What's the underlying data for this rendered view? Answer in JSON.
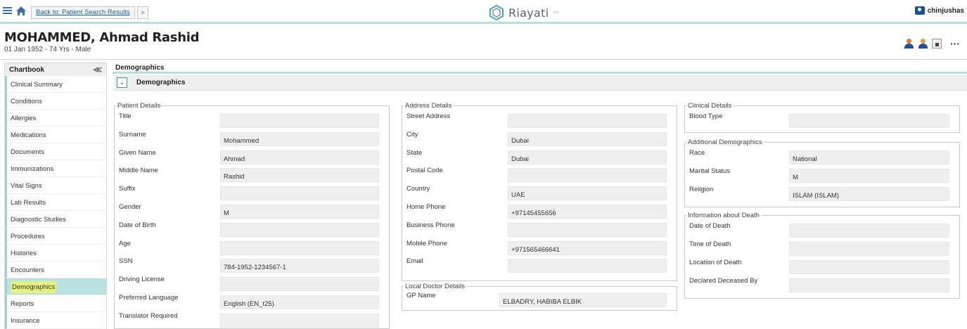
{
  "topbar": {
    "back_link": "Back to: Patient Search Results",
    "back_arrow": ">",
    "brand": "Riayati",
    "brand_sub": "≡≡≡",
    "user": "chinjushas"
  },
  "patient": {
    "name": "MOHAMMED, Ahmad Rashid",
    "info": "01 Jan 1952 - 74 Yrs - Male",
    "more": "···"
  },
  "sidebar": {
    "title": "Chartbook",
    "collapse": "≪",
    "items": [
      "Clinical Summary",
      "Conditions",
      "Allergies",
      "Medications",
      "Documents",
      "Immunizations",
      "Vital Signs",
      "Lab Results",
      "Diagnostic Studies",
      "Procedures",
      "Histories",
      "Encounters",
      "Demographics",
      "Reports",
      "Insurance"
    ],
    "active": "Demographics"
  },
  "main": {
    "title": "Demographics",
    "section_title": "Demographics",
    "toggle": "⌄"
  },
  "patient_details": {
    "legend": "Patient Details",
    "fields": [
      {
        "label": "Title",
        "value": ""
      },
      {
        "label": "Surname",
        "value": "Mohammed"
      },
      {
        "label": "Given Name",
        "value": "Ahmad"
      },
      {
        "label": "Middle Name",
        "value": "Rashid"
      },
      {
        "label": "Suffix",
        "value": ""
      },
      {
        "label": "Gender",
        "value": "M"
      },
      {
        "label": "Date of Birth",
        "value": ""
      },
      {
        "label": "Age",
        "value": ""
      },
      {
        "label": "SSN",
        "value": "784-1952-1234567-1"
      },
      {
        "label": "Driving License",
        "value": ""
      },
      {
        "label": "Preferred Language",
        "value": "English (EN_t25)"
      },
      {
        "label": "Translator Required",
        "value": ""
      }
    ]
  },
  "address_details": {
    "legend": "Address Details",
    "fields": [
      {
        "label": "Street Address",
        "value": ""
      },
      {
        "label": "City",
        "value": "Dubai"
      },
      {
        "label": "State",
        "value": "Dubai"
      },
      {
        "label": "Postal Code",
        "value": ""
      },
      {
        "label": "Country",
        "value": "UAE"
      },
      {
        "label": "Home Phone",
        "value": "+97145455656"
      },
      {
        "label": "Business Phone",
        "value": ""
      },
      {
        "label": "Mobile Phone",
        "value": "+971565466641"
      },
      {
        "label": "Email",
        "value": ""
      }
    ]
  },
  "local_doctor": {
    "legend": "Local Doctor Details",
    "fields": [
      {
        "label": "GP Name",
        "value": "ELBADRY, HABIBA ELBIK"
      }
    ]
  },
  "clinical_details": {
    "legend": "Clinical Details",
    "fields": [
      {
        "label": "Blood Type",
        "value": ""
      }
    ]
  },
  "additional_demographics": {
    "legend": "Additional Demographics",
    "fields": [
      {
        "label": "Race",
        "value": "National"
      },
      {
        "label": "Marital Status",
        "value": "M"
      },
      {
        "label": "Religion",
        "value": "ISLAM (ISLAM)"
      }
    ]
  },
  "death_info": {
    "legend": "Information about Death",
    "fields": [
      {
        "label": "Date of Death",
        "value": ""
      },
      {
        "label": "Time of Death",
        "value": ""
      },
      {
        "label": "Location of Death",
        "value": ""
      },
      {
        "label": "Declared Deceased By",
        "value": ""
      }
    ]
  },
  "colors": {
    "accent": "#b9dede",
    "link": "#1a5aa8",
    "active_item": "#b9e1e1",
    "highlight": "#e6f57a"
  }
}
